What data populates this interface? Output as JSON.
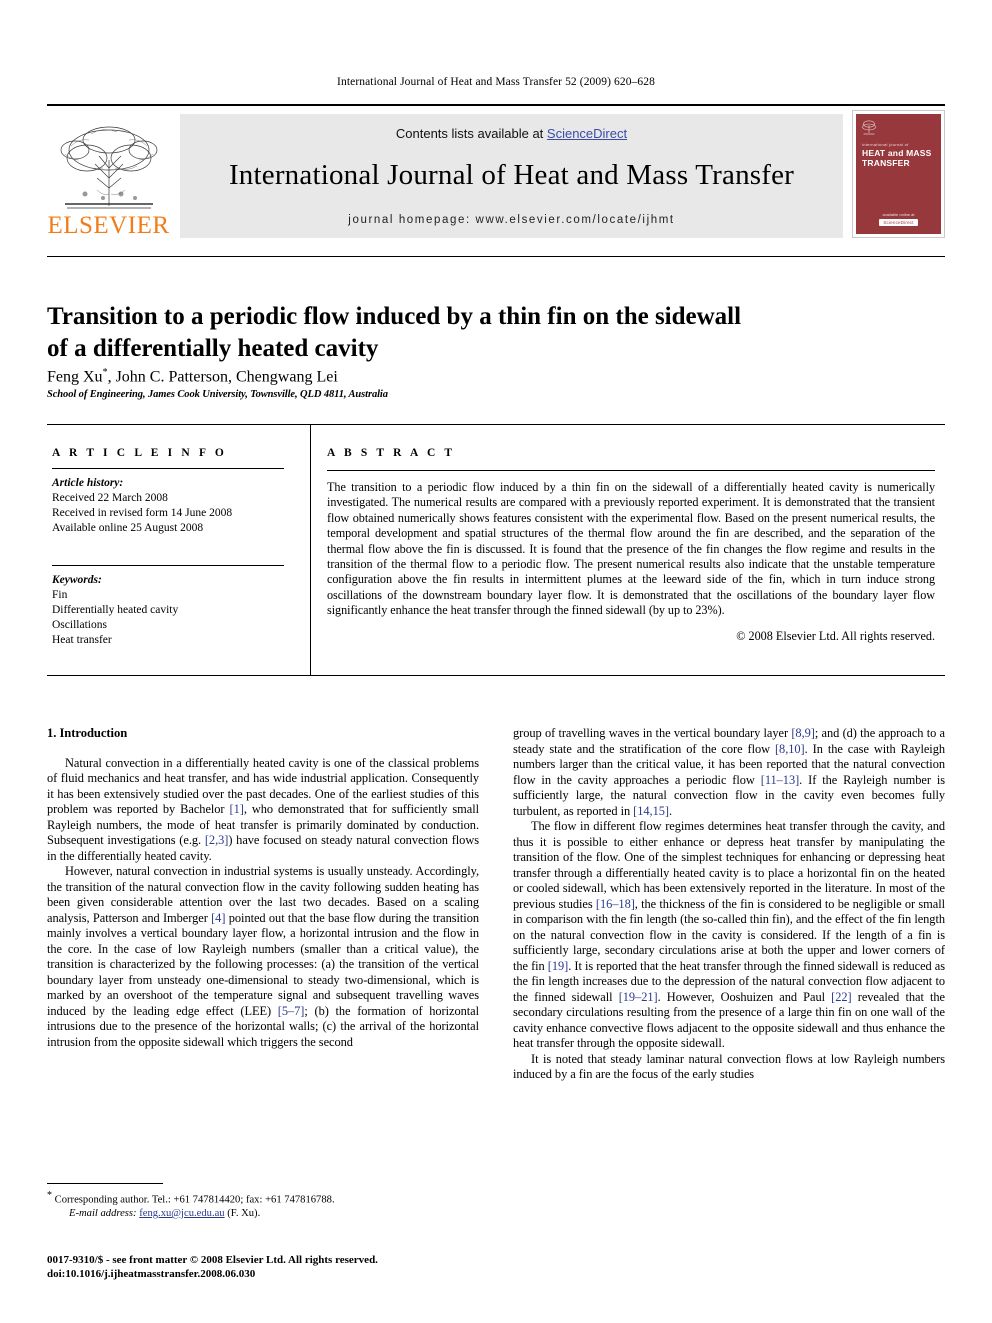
{
  "running_head": "International Journal of Heat and Mass Transfer 52 (2009) 620–628",
  "masthead": {
    "publisher_name": "ELSEVIER",
    "contents_prefix": "Contents lists available at ",
    "sciencedirect": "ScienceDirect",
    "journal_title": "International Journal of Heat and Mass Transfer",
    "homepage": "journal homepage: www.elsevier.com/locate/ijhmt",
    "cover": {
      "kicker": "international journal of",
      "title": "HEAT and MASS TRANSFER",
      "footer_top": "available online at",
      "footer_badge": "ScienceDirect"
    },
    "colors": {
      "elsevier_orange": "#F07D1A",
      "link_blue": "#3A4CA8",
      "band_gray": "#e8e8e8",
      "cover_red": "#97383C"
    }
  },
  "article": {
    "title_line1": "Transition to a periodic flow induced by a thin fin on the sidewall",
    "title_line2": "of a differentially heated cavity",
    "authors": "Feng Xu",
    "author_star": "*",
    "authors_rest": ", John C. Patterson, Chengwang Lei",
    "affiliation": "School of Engineering, James Cook University, Townsville, QLD 4811, Australia"
  },
  "info": {
    "heading": "A R T I C L E   I N F O",
    "history_label": "Article history:",
    "history": [
      "Received 22 March 2008",
      "Received in revised form 14 June 2008",
      "Available online 25 August 2008"
    ],
    "keywords_label": "Keywords:",
    "keywords": [
      "Fin",
      "Differentially heated cavity",
      "Oscillations",
      "Heat transfer"
    ]
  },
  "abstract": {
    "heading": "A B S T R A C T",
    "text": "The transition to a periodic flow induced by a thin fin on the sidewall of a differentially heated cavity is numerically investigated. The numerical results are compared with a previously reported experiment. It is demonstrated that the transient flow obtained numerically shows features consistent with the experimental flow. Based on the present numerical results, the temporal development and spatial structures of the thermal flow around the fin are described, and the separation of the thermal flow above the fin is discussed. It is found that the presence of the fin changes the flow regime and results in the transition of the thermal flow to a periodic flow. The present numerical results also indicate that the unstable temperature configuration above the fin results in intermittent plumes at the leeward side of the fin, which in turn induce strong oscillations of the downstream boundary layer flow. It is demonstrated that the oscillations of the boundary layer flow significantly enhance the heat transfer through the finned sidewall (by up to 23%).",
    "copyright": "© 2008 Elsevier Ltd. All rights reserved."
  },
  "body": {
    "section_heading": "1. Introduction",
    "left_p1_a": "Natural convection in a differentially heated cavity is one of the classical problems of fluid mechanics and heat transfer, and has wide industrial application. Consequently it has been extensively studied over the past decades. One of the earliest studies of this problem was reported by Bachelor ",
    "left_p1_ref1": "[1]",
    "left_p1_b": ", who demonstrated that for sufficiently small Rayleigh numbers, the mode of heat transfer is primarily dominated by conduction. Subsequent investigations (e.g. ",
    "left_p1_ref2": "[2,3]",
    "left_p1_c": ") have focused on steady natural convection flows in the differentially heated cavity.",
    "left_p2_a": "However, natural convection in industrial systems is usually unsteady. Accordingly, the transition of the natural convection flow in the cavity following sudden heating has been given considerable attention over the last two decades. Based on a scaling analysis, Patterson and Imberger ",
    "left_p2_ref1": "[4]",
    "left_p2_b": " pointed out that the base flow during the transition mainly involves a vertical boundary layer flow, a horizontal intrusion and the flow in the core. In the case of low Rayleigh numbers (smaller than a critical value), the transition is characterized by the following processes: (a) the transition of the vertical boundary layer from unsteady one-dimensional to steady two-dimensional, which is marked by an overshoot of the temperature signal and subsequent travelling waves induced by the leading edge effect (LEE) ",
    "left_p2_ref2": "[5–7]",
    "left_p2_c": "; (b) the formation of horizontal intrusions due to the presence of the horizontal walls; (c) the arrival of the horizontal intrusion from the opposite sidewall which triggers the second",
    "right_p1_a": "group of travelling waves in the vertical boundary layer ",
    "right_p1_ref1": "[8,9]",
    "right_p1_b": "; and (d) the approach to a steady state and the stratification of the core flow ",
    "right_p1_ref2": "[8,10]",
    "right_p1_c": ". In the case with Rayleigh numbers larger than the critical value, it has been reported that the natural convection flow in the cavity approaches a periodic flow ",
    "right_p1_ref3": "[11–13]",
    "right_p1_d": ". If the Rayleigh number is sufficiently large, the natural convection flow in the cavity even becomes fully turbulent, as reported in ",
    "right_p1_ref4": "[14,15]",
    "right_p1_e": ".",
    "right_p2_a": "The flow in different flow regimes determines heat transfer through the cavity, and thus it is possible to either enhance or depress heat transfer by manipulating the transition of the flow. One of the simplest techniques for enhancing or depressing heat transfer through a differentially heated cavity is to place a horizontal fin on the heated or cooled sidewall, which has been extensively reported in the literature. In most of the previous studies ",
    "right_p2_ref1": "[16–18]",
    "right_p2_b": ", the thickness of the fin is considered to be negligible or small in comparison with the fin length (the so-called thin fin), and the effect of the fin length on the natural convection flow in the cavity is considered. If the length of a fin is sufficiently large, secondary circulations arise at both the upper and lower corners of the fin ",
    "right_p2_ref2": "[19]",
    "right_p2_c": ". It is reported that the heat transfer through the finned sidewall is reduced as the fin length increases due to the depression of the natural convection flow adjacent to the finned sidewall ",
    "right_p2_ref3": "[19–21]",
    "right_p2_d": ". However, Ooshuizen and Paul ",
    "right_p2_ref4": "[22]",
    "right_p2_e": " revealed that the secondary circulations resulting from the presence of a large thin fin on one wall of the cavity enhance convective flows adjacent to the opposite sidewall and thus enhance the heat transfer through the opposite sidewall.",
    "right_p3": "It is noted that steady laminar natural convection flows at low Rayleigh numbers induced by a fin are the focus of the early studies"
  },
  "footnote": {
    "star": "*",
    "corresponding": " Corresponding author. Tel.: +61 747814420; fax: +61 747816788.",
    "email_label": "E-mail address:",
    "email": "feng.xu@jcu.edu.au",
    "email_suffix": " (F. Xu)."
  },
  "footer": {
    "line1": "0017-9310/$ - see front matter © 2008 Elsevier Ltd. All rights reserved.",
    "line2": "doi:10.1016/j.ijheatmasstransfer.2008.06.030"
  }
}
